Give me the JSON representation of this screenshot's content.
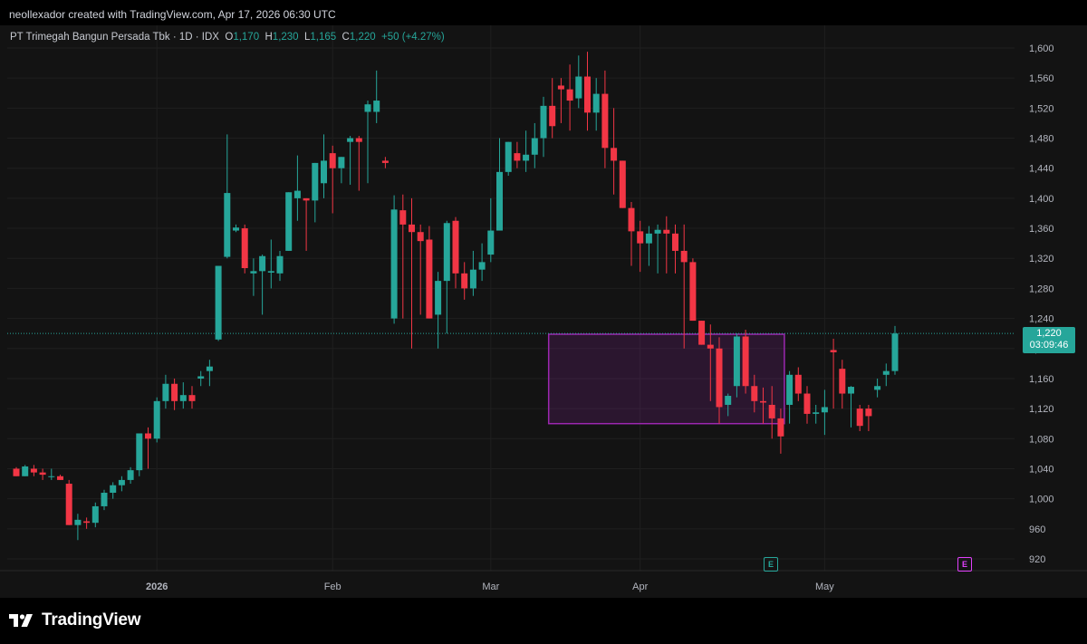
{
  "caption": "neollexador created with TradingView.com, Apr 17, 2026 06:30 UTC",
  "legend": {
    "title": "PT Trimegah Bangun Persada Tbk · 1D · IDX",
    "o_key": "O",
    "o_val": "1,170",
    "h_key": "H",
    "h_val": "1,230",
    "l_key": "L",
    "l_val": "1,165",
    "c_key": "C",
    "c_val": "1,220",
    "change": "+50 (+4.27%)"
  },
  "price_tag": {
    "price": "1,220",
    "countdown": "03:09:46"
  },
  "events": [
    {
      "label": "E",
      "date": "Apr",
      "color": "#26a69a"
    },
    {
      "label": "E",
      "date": "May",
      "color": "#e040fb"
    }
  ],
  "brand": {
    "name": "TradingView"
  },
  "colors": {
    "up": "#26a69a",
    "down": "#f23645",
    "box": "#9c27b0",
    "background": "#131313"
  },
  "chart_data": {
    "type": "candlestick",
    "y_ticks": [
      "1,600",
      "1,560",
      "1,520",
      "1,480",
      "1,440",
      "1,400",
      "1,360",
      "1,320",
      "1,280",
      "1,240",
      "1,200",
      "1,160",
      "1,120",
      "1,080",
      "1,040",
      "1,000",
      "960",
      "920"
    ],
    "ylim": [
      905,
      1620
    ],
    "x_labels": [
      {
        "label": "2026",
        "index": 16,
        "bold": true
      },
      {
        "label": "Feb",
        "index": 36,
        "bold": false
      },
      {
        "label": "Mar",
        "index": 54,
        "bold": false
      },
      {
        "label": "Apr",
        "index": 71,
        "bold": false
      },
      {
        "label": "May",
        "index": 92,
        "bold": false
      }
    ],
    "last_price": 1220,
    "range_box": {
      "start_index": 61,
      "end_index": 87,
      "top": 1219,
      "bottom": 1100
    },
    "candles": [
      [
        1040,
        1042,
        1030,
        1030
      ],
      [
        1030,
        1045,
        1030,
        1043
      ],
      [
        1040,
        1045,
        1030,
        1035
      ],
      [
        1035,
        1040,
        1025,
        1032
      ],
      [
        1030,
        1040,
        1025,
        1030
      ],
      [
        1030,
        1032,
        1025,
        1025
      ],
      [
        1020,
        1025,
        965,
        965
      ],
      [
        965,
        980,
        945,
        972
      ],
      [
        970,
        975,
        960,
        968
      ],
      [
        968,
        995,
        962,
        990
      ],
      [
        990,
        1012,
        985,
        1008
      ],
      [
        1008,
        1022,
        1000,
        1018
      ],
      [
        1018,
        1030,
        1010,
        1025
      ],
      [
        1025,
        1042,
        1020,
        1038
      ],
      [
        1038,
        1085,
        1030,
        1087
      ],
      [
        1087,
        1095,
        1040,
        1080
      ],
      [
        1080,
        1135,
        1075,
        1130
      ],
      [
        1130,
        1165,
        1120,
        1153
      ],
      [
        1153,
        1160,
        1118,
        1130
      ],
      [
        1130,
        1155,
        1120,
        1138
      ],
      [
        1138,
        1150,
        1120,
        1130
      ],
      [
        1160,
        1170,
        1150,
        1163
      ],
      [
        1170,
        1185,
        1150,
        1176
      ],
      [
        1212,
        1304,
        1210,
        1310
      ],
      [
        1322,
        1485,
        1320,
        1407
      ],
      [
        1357,
        1365,
        1355,
        1361
      ],
      [
        1360,
        1365,
        1300,
        1307
      ],
      [
        1300,
        1320,
        1270,
        1303
      ],
      [
        1303,
        1325,
        1245,
        1323
      ],
      [
        1301,
        1345,
        1280,
        1303
      ],
      [
        1300,
        1330,
        1290,
        1323
      ],
      [
        1330,
        1408,
        1340,
        1408
      ],
      [
        1400,
        1457,
        1370,
        1410
      ],
      [
        1400,
        1360,
        1330,
        1397
      ],
      [
        1397,
        1440,
        1368,
        1447
      ],
      [
        1420,
        1485,
        1400,
        1450
      ],
      [
        1460,
        1470,
        1380,
        1440
      ],
      [
        1440,
        1450,
        1420,
        1455
      ],
      [
        1475,
        1483,
        1418,
        1480
      ],
      [
        1480,
        1483,
        1410,
        1475
      ],
      [
        1515,
        1530,
        1420,
        1525
      ],
      [
        1515,
        1570,
        1500,
        1530
      ],
      [
        1450,
        1455,
        1440,
        1447
      ],
      [
        1240,
        1404,
        1233,
        1385
      ],
      [
        1384,
        1405,
        1240,
        1365
      ],
      [
        1365,
        1400,
        1200,
        1355
      ],
      [
        1355,
        1365,
        1245,
        1343
      ],
      [
        1345,
        1363,
        1260,
        1240
      ],
      [
        1245,
        1302,
        1200,
        1290
      ],
      [
        1290,
        1370,
        1220,
        1367
      ],
      [
        1370,
        1375,
        1280,
        1300
      ],
      [
        1300,
        1315,
        1265,
        1280
      ],
      [
        1280,
        1330,
        1270,
        1305
      ],
      [
        1305,
        1340,
        1290,
        1315
      ],
      [
        1325,
        1400,
        1315,
        1357
      ],
      [
        1357,
        1480,
        1360,
        1435
      ],
      [
        1435,
        1465,
        1430,
        1475
      ],
      [
        1460,
        1475,
        1440,
        1450
      ],
      [
        1450,
        1490,
        1435,
        1458
      ],
      [
        1458,
        1500,
        1440,
        1480
      ],
      [
        1480,
        1535,
        1455,
        1523
      ],
      [
        1523,
        1560,
        1480,
        1496
      ],
      [
        1550,
        1560,
        1500,
        1545
      ],
      [
        1545,
        1578,
        1490,
        1530
      ],
      [
        1533,
        1590,
        1520,
        1562
      ],
      [
        1562,
        1595,
        1490,
        1514
      ],
      [
        1514,
        1560,
        1490,
        1539
      ],
      [
        1539,
        1570,
        1440,
        1467
      ],
      [
        1467,
        1520,
        1405,
        1450
      ],
      [
        1450,
        1440,
        1395,
        1387
      ],
      [
        1387,
        1395,
        1310,
        1356
      ],
      [
        1356,
        1370,
        1302,
        1340
      ],
      [
        1340,
        1363,
        1310,
        1353
      ],
      [
        1353,
        1365,
        1300,
        1358
      ],
      [
        1358,
        1376,
        1300,
        1353
      ],
      [
        1353,
        1365,
        1300,
        1330
      ],
      [
        1330,
        1365,
        1200,
        1315
      ],
      [
        1315,
        1320,
        1243,
        1237
      ],
      [
        1237,
        1210,
        1228,
        1205
      ],
      [
        1205,
        1232,
        1130,
        1200
      ],
      [
        1200,
        1215,
        1100,
        1122
      ],
      [
        1125,
        1140,
        1110,
        1137
      ],
      [
        1150,
        1220,
        1135,
        1216
      ],
      [
        1216,
        1225,
        1140,
        1150
      ],
      [
        1150,
        1165,
        1115,
        1130
      ],
      [
        1130,
        1148,
        1100,
        1128
      ],
      [
        1125,
        1150,
        1080,
        1107
      ],
      [
        1107,
        1120,
        1060,
        1083
      ],
      [
        1125,
        1170,
        1100,
        1165
      ],
      [
        1165,
        1175,
        1130,
        1140
      ],
      [
        1140,
        1150,
        1100,
        1113
      ],
      [
        1113,
        1125,
        1100,
        1115
      ],
      [
        1115,
        1145,
        1085,
        1122
      ],
      [
        1198,
        1213,
        1120,
        1195
      ],
      [
        1173,
        1185,
        1120,
        1140
      ],
      [
        1140,
        1150,
        1095,
        1149
      ],
      [
        1120,
        1125,
        1090,
        1097
      ],
      [
        1120,
        1125,
        1090,
        1110
      ],
      [
        1145,
        1160,
        1135,
        1150
      ],
      [
        1165,
        1180,
        1150,
        1170
      ],
      [
        1170,
        1230,
        1165,
        1220
      ]
    ]
  }
}
